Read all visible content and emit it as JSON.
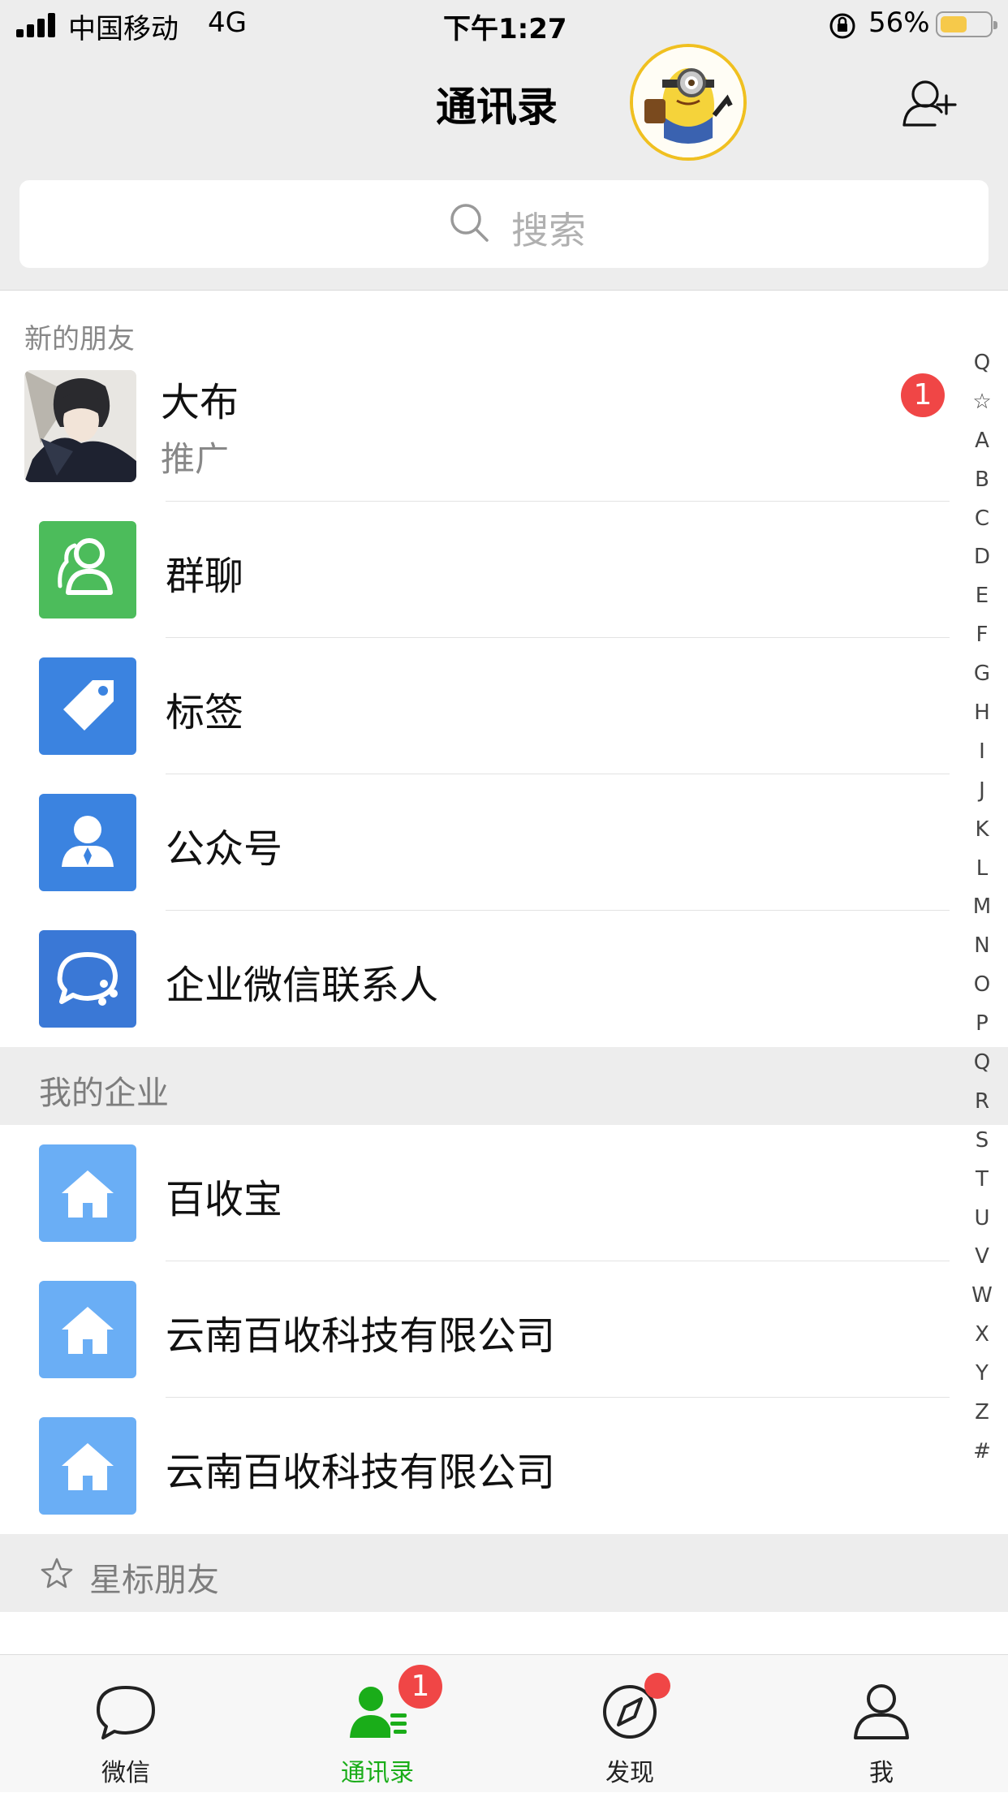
{
  "status_bar": {
    "carrier": "中国移动",
    "network": "4G",
    "time": "下午1:27",
    "battery": "56%",
    "battery_level": 0.56
  },
  "nav": {
    "title": "通讯录",
    "avatar_icon": "minion-avatar",
    "add_icon": "add-contact-icon"
  },
  "search": {
    "placeholder": "搜索"
  },
  "new_friends": {
    "section_label": "新的朋友",
    "item": {
      "name": "大布",
      "subtitle": "推广",
      "badge": "1"
    }
  },
  "functions": [
    {
      "label": "群聊",
      "icon": "group-chat-icon",
      "color": "#4cbc5b"
    },
    {
      "label": "标签",
      "icon": "tag-icon",
      "color": "#3b83e0"
    },
    {
      "label": "公众号",
      "icon": "official-account-icon",
      "color": "#3b83e0"
    },
    {
      "label": "企业微信联系人",
      "icon": "wecom-contacts-icon",
      "color": "#3a78d6"
    }
  ],
  "enterprise": {
    "section_label": "我的企业",
    "items": [
      {
        "label": "百收宝"
      },
      {
        "label": "云南百收科技有限公司"
      },
      {
        "label": "云南百收科技有限公司"
      }
    ]
  },
  "starred": {
    "section_label": "星标朋友"
  },
  "index_bar": [
    "Q",
    "☆",
    "A",
    "B",
    "C",
    "D",
    "E",
    "F",
    "G",
    "H",
    "I",
    "J",
    "K",
    "L",
    "M",
    "N",
    "O",
    "P",
    "Q",
    "R",
    "S",
    "T",
    "U",
    "V",
    "W",
    "X",
    "Y",
    "Z",
    "#"
  ],
  "tabbar": {
    "tabs": [
      {
        "label": "微信"
      },
      {
        "label": "通讯录",
        "badge": "1",
        "active": true
      },
      {
        "label": "发现",
        "dot": true
      },
      {
        "label": "我"
      }
    ],
    "active_color": "#1aad19"
  }
}
